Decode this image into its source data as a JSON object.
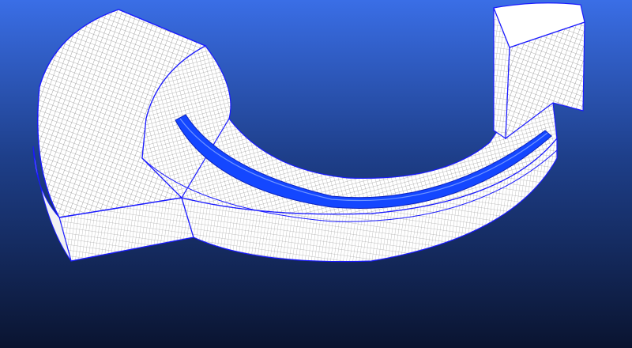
{
  "viewport": {
    "background": {
      "top_color": "#3a6ee6",
      "mid_color": "#1e3f8a",
      "bottom_color": "#0a1430"
    },
    "model": {
      "mesh_color": "#ffffff",
      "mesh_shade_color": "#cfcfcf",
      "mesh_line_color": "#5a5a5a",
      "edge_color": "#1a1aff",
      "slot_color": "#1447ff"
    }
  }
}
